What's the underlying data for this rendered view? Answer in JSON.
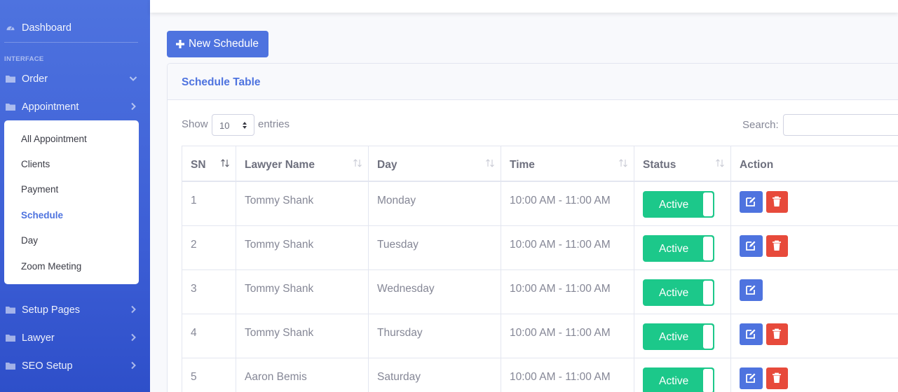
{
  "sidebar": {
    "dashboard": "Dashboard",
    "heading": "INTERFACE",
    "items": {
      "order": "Order",
      "appointment": "Appointment",
      "setup_pages": "Setup Pages",
      "lawyer": "Lawyer",
      "seo_setup": "SEO Setup"
    },
    "submenu": [
      "All Appointment",
      "Clients",
      "Payment",
      "Schedule",
      "Day",
      "Zoom Meeting"
    ],
    "active_submenu": "Schedule"
  },
  "toolbar": {
    "new_schedule_label": "New Schedule"
  },
  "card": {
    "title": "Schedule Table"
  },
  "table_controls": {
    "show_label": "Show",
    "entries_value": "10",
    "entries_label": "entries",
    "search_label": "Search:"
  },
  "table": {
    "headers": [
      "SN",
      "Lawyer Name",
      "Day",
      "Time",
      "Status",
      "Action"
    ],
    "rows": [
      {
        "sn": "1",
        "lawyer": "Tommy Shank",
        "day": "Monday",
        "time": "10:00 AM - 11:00 AM",
        "status": "Active",
        "has_delete": true
      },
      {
        "sn": "2",
        "lawyer": "Tommy Shank",
        "day": "Tuesday",
        "time": "10:00 AM - 11:00 AM",
        "status": "Active",
        "has_delete": true
      },
      {
        "sn": "3",
        "lawyer": "Tommy Shank",
        "day": "Wednesday",
        "time": "10:00 AM - 11:00 AM",
        "status": "Active",
        "has_delete": false
      },
      {
        "sn": "4",
        "lawyer": "Tommy Shank",
        "day": "Thursday",
        "time": "10:00 AM - 11:00 AM",
        "status": "Active",
        "has_delete": true
      },
      {
        "sn": "5",
        "lawyer": "Aaron Bemis",
        "day": "Saturday",
        "time": "10:00 AM - 11:00 AM",
        "status": "Active",
        "has_delete": true
      }
    ]
  },
  "colors": {
    "primary": "#4e73df",
    "success": "#1cc88a",
    "danger": "#e74a3b"
  },
  "icons": {
    "dashboard": "tachometer-icon",
    "folder": "folder-icon",
    "chevron_down": "chevron-down-icon",
    "chevron_right": "chevron-right-icon",
    "plus": "plus-icon",
    "sort": "sort-icon",
    "edit": "edit-icon",
    "delete": "trash-icon"
  }
}
